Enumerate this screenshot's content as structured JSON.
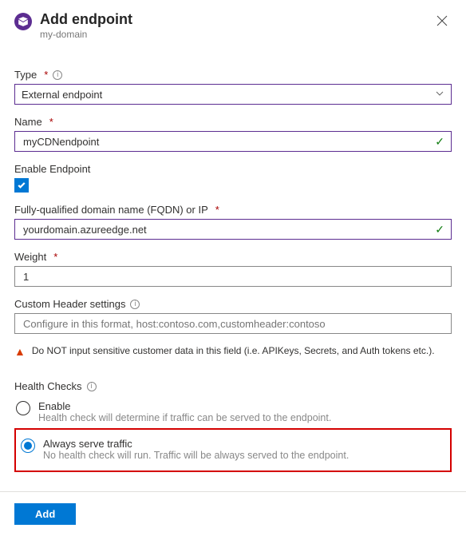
{
  "header": {
    "title": "Add endpoint",
    "subtitle": "my-domain"
  },
  "type": {
    "label": "Type",
    "value": "External endpoint"
  },
  "name": {
    "label": "Name",
    "value": "myCDNendpoint"
  },
  "enableEndpoint": {
    "label": "Enable Endpoint"
  },
  "fqdn": {
    "label": "Fully-qualified domain name (FQDN) or IP",
    "value": "yourdomain.azureedge.net"
  },
  "weight": {
    "label": "Weight",
    "value": "1"
  },
  "customHeader": {
    "label": "Custom Header settings",
    "placeholder": "Configure in this format, host:contoso.com,customheader:contoso"
  },
  "warning": "Do NOT input sensitive customer data in this field (i.e. APIKeys, Secrets, and Auth tokens etc.).",
  "healthChecks": {
    "label": "Health Checks",
    "enable": {
      "label": "Enable",
      "desc": "Health check will determine if traffic can be served to the endpoint."
    },
    "always": {
      "label": "Always serve traffic",
      "desc": "No health check will run. Traffic will be always served to the endpoint."
    }
  },
  "footer": {
    "add": "Add"
  }
}
